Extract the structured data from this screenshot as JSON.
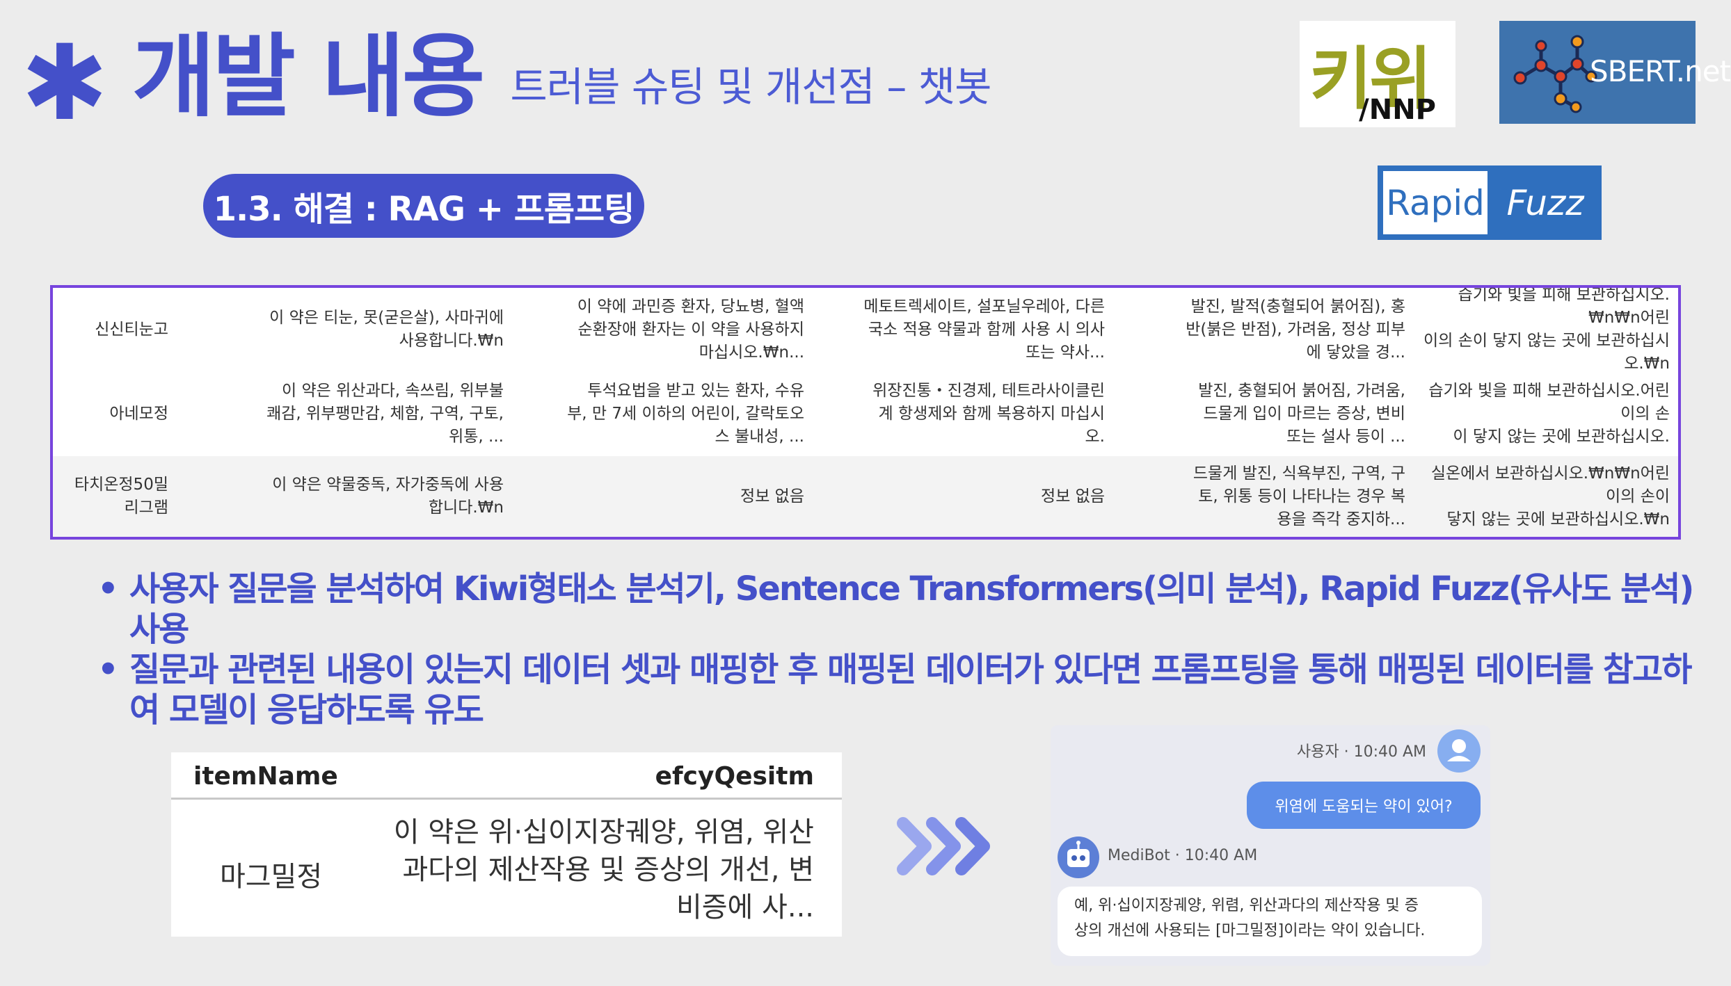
{
  "header": {
    "asterisk": "✱",
    "title": "개발 내용",
    "subtitle": "트러블 슈팅 및 개선점 – 챗봇"
  },
  "logos": {
    "kiwi_word": "키위",
    "kiwi_sub": "/NNP",
    "sbert": "SBERT.net",
    "rapid": "Rapid",
    "fuzz": "Fuzz"
  },
  "section": {
    "label": "1.3. 해결 : RAG + 프롬프팅"
  },
  "drug_table": {
    "rows": [
      {
        "name": [
          "신신티눈고"
        ],
        "efficacy": [
          "이 약은 티눈, 못(굳은살), 사마귀에",
          "사용합니다.₩n"
        ],
        "warning": [
          "이 약에 과민증 환자, 당뇨병, 혈액",
          "순환장애 환자는 이 약을 사용하지",
          "마십시오.₩n..."
        ],
        "interaction": [
          "메토트렉세이트, 설포닐우레아, 다른",
          "국소 적용 약물과 함께 사용 시 의사",
          "또는 약사..."
        ],
        "side_effect": [
          "발진, 발적(충혈되어 붉어짐), 홍",
          "반(붉은 반점), 가려움, 정상 피부",
          "에 닿았을 경..."
        ],
        "storage": [
          "습기와 빛을 피해 보관하십시오.₩n₩n어린",
          "이의 손이 닿지 않는 곳에 보관하십시오.₩n"
        ]
      },
      {
        "name": [
          "아네모정"
        ],
        "efficacy": [
          "이 약은 위산과다, 속쓰림, 위부불",
          "쾌감, 위부팽만감, 체함, 구역, 구토,",
          "위통, ..."
        ],
        "warning": [
          "투석요법을 받고 있는 환자, 수유",
          "부, 만 7세 이하의 어린이, 갈락토오",
          "스 불내성, ..."
        ],
        "interaction": [
          "위장진통・진경제, 테트라사이클린",
          "계 항생제와 함께 복용하지 마십시",
          "오."
        ],
        "side_effect": [
          "발진, 충혈되어 붉어짐, 가려움,",
          "드물게 입이 마르는 증상, 변비",
          "또는 설사 등이 ..."
        ],
        "storage": [
          "습기와 빛을 피해 보관하십시오.어린이의 손",
          "이 닿지 않는 곳에 보관하십시오."
        ]
      },
      {
        "name": [
          "타치온정50밀",
          "리그램"
        ],
        "efficacy": [
          "이 약은 약물중독, 자가중독에 사용",
          "합니다.₩n"
        ],
        "warning": [
          "정보 없음"
        ],
        "interaction": [
          "정보 없음"
        ],
        "side_effect": [
          "드물게 발진, 식욕부진, 구역, 구",
          "토, 위통 등이 나타나는 경우 복",
          "용을 즉각 중지하..."
        ],
        "storage": [
          "실온에서 보관하십시오.₩n₩n어린이의 손이",
          "닿지 않는 곳에 보관하십시오.₩n"
        ]
      }
    ]
  },
  "bullets": [
    "사용자 질문을 분석하여 Kiwi형태소 분석기, Sentence Transformers(의미 분석), Rapid Fuzz(유사도 분석) 사용",
    "질문과 관련된 내용이 있는지 데이터 셋과 매핑한 후 매핑된 데이터가 있다면 프롬프팅을 통해 매핑된 데이터를 참고하여 모델이 응답하도록 유도"
  ],
  "mini_table": {
    "col1": "itemName",
    "col2": "efcyQesitm",
    "name": "마그밀정",
    "desc": [
      "이 약은 위·십이지장궤양, 위염, 위산",
      "과다의 제산작용 및 증상의 개선, 변",
      "비증에 사..."
    ]
  },
  "chat": {
    "user_meta": "사용자 · 10:40 AM",
    "user_message": "위염에 도움되는 약이 있어?",
    "bot_meta": "MediBot · 10:40 AM",
    "bot_message": [
      "예, 위·십이지장궤양, 위렴, 위산과다의 제산작용 및 증",
      "상의 개선에 사용되는 [마그밀정]이라는 약이 있습니다."
    ]
  },
  "colors": {
    "accent": "#4450c9",
    "table_border": "#7744dd",
    "user_bubble": "#5d8ee9",
    "arrow": "#7c8ae6"
  }
}
